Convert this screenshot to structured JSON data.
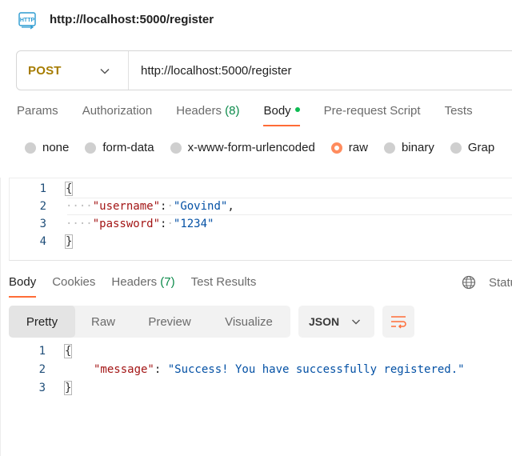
{
  "header": {
    "title": "http://localhost:5000/register",
    "icon": "http-icon"
  },
  "request": {
    "method": "POST",
    "url": "http://localhost:5000/register",
    "tabs": [
      {
        "label": "Params"
      },
      {
        "label": "Authorization"
      },
      {
        "label": "Headers",
        "count": "(8)"
      },
      {
        "label": "Body",
        "active": true,
        "indicator": "dot"
      },
      {
        "label": "Pre-request Script"
      },
      {
        "label": "Tests"
      }
    ],
    "body_modes": [
      "none",
      "form-data",
      "x-www-form-urlencoded",
      "raw",
      "binary",
      "Grap"
    ],
    "selected_mode": "raw",
    "body_lines": [
      {
        "num": "1",
        "text": "{"
      },
      {
        "num": "2",
        "key": "\"username\"",
        "value": "\"Govind\"",
        "trail": ","
      },
      {
        "num": "3",
        "key": "\"password\"",
        "value": "\"1234\"",
        "trail": ""
      },
      {
        "num": "4",
        "text": "}"
      }
    ]
  },
  "response": {
    "tabs": [
      {
        "label": "Body",
        "active": true
      },
      {
        "label": "Cookies"
      },
      {
        "label": "Headers",
        "count": "(7)"
      },
      {
        "label": "Test Results"
      }
    ],
    "status_label": "Statu",
    "view_modes": [
      "Pretty",
      "Raw",
      "Preview",
      "Visualize"
    ],
    "active_view": "Pretty",
    "format": "JSON",
    "body_lines": [
      {
        "num": "1",
        "text": "{"
      },
      {
        "num": "2",
        "key": "\"message\"",
        "value": "\"Success! You have successfully registered.\""
      },
      {
        "num": "3",
        "text": "}"
      }
    ]
  },
  "colors": {
    "accent": "#ff6c37",
    "method": "#a67c00",
    "key": "#a31515",
    "string": "#0451a5",
    "count": "#0b8a4a",
    "dot": "#0cbb52"
  }
}
